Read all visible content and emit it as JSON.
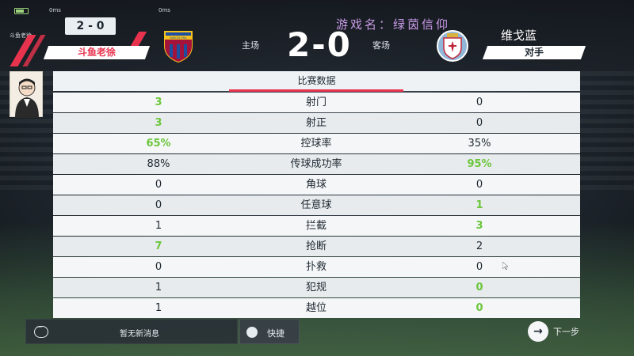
{
  "status": {
    "ping_left": "0ms",
    "ping_right": "0ms",
    "mini_score": "2 - 0",
    "mini_left_label": "斗鱼老徐"
  },
  "header": {
    "home_name": "斗鱼老徐",
    "home_label": "主场",
    "score": "2-0",
    "away_label": "客场",
    "away_title": "维戈蓝",
    "away_name": "对手",
    "watermark": "游戏名：绿茵信仰",
    "home_crest_text": "BARCELONA"
  },
  "panel": {
    "title": "比赛数据",
    "rows": [
      {
        "home": "3",
        "label": "射门",
        "away": "0",
        "winner": "home"
      },
      {
        "home": "3",
        "label": "射正",
        "away": "0",
        "winner": "home"
      },
      {
        "home": "65%",
        "label": "控球率",
        "away": "35%",
        "winner": "home"
      },
      {
        "home": "88%",
        "label": "传球成功率",
        "away": "95%",
        "winner": "away"
      },
      {
        "home": "0",
        "label": "角球",
        "away": "0",
        "winner": "none"
      },
      {
        "home": "0",
        "label": "任意球",
        "away": "1",
        "winner": "away"
      },
      {
        "home": "1",
        "label": "拦截",
        "away": "3",
        "winner": "away"
      },
      {
        "home": "7",
        "label": "抢断",
        "away": "2",
        "winner": "home"
      },
      {
        "home": "0",
        "label": "扑救",
        "away": "0",
        "winner": "none"
      },
      {
        "home": "1",
        "label": "犯规",
        "away": "0",
        "winner": "away"
      },
      {
        "home": "1",
        "label": "越位",
        "away": "0",
        "winner": "away"
      }
    ]
  },
  "bottom": {
    "message": "暂无新消息",
    "quick": "快捷",
    "next": "下一步"
  },
  "colors": {
    "accent_red": "#e8334e",
    "highlight_green": "#6cc63c",
    "watermark_purple": "#c89ae6"
  },
  "icons": {
    "message": "chat-bubble-icon",
    "quick": "quick-chat-icon",
    "next": "arrow-right-circle-icon",
    "cursor": "mouse-pointer-icon"
  }
}
